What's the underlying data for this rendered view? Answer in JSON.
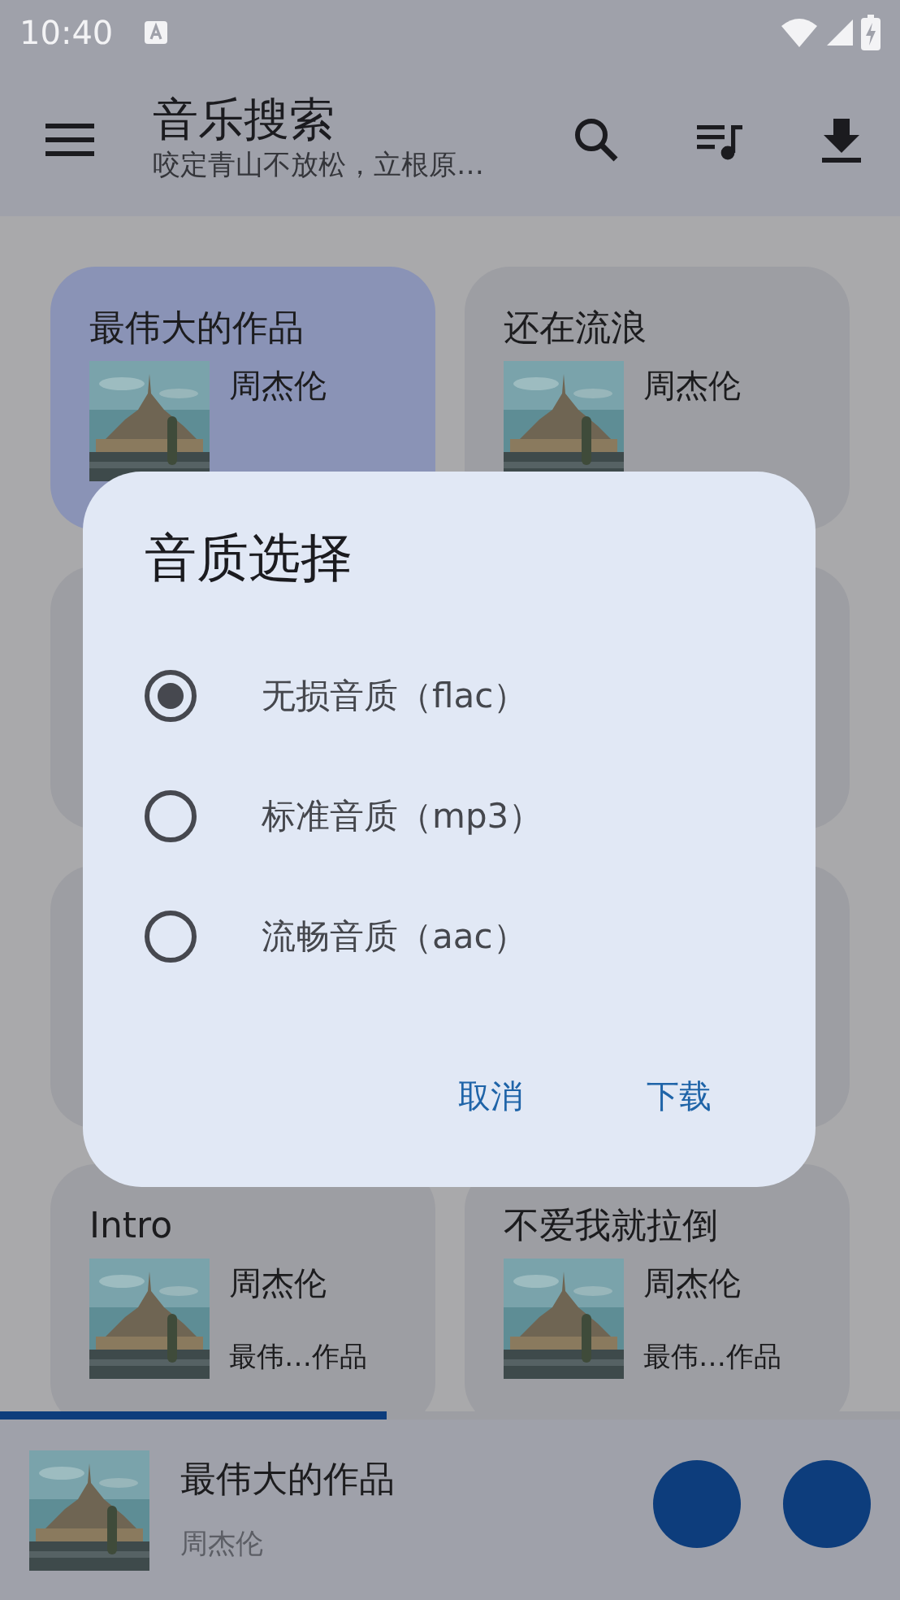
{
  "status_bar": {
    "time": "10:40"
  },
  "app_bar": {
    "title": "音乐搜索",
    "subtitle": "咬定青山不放松，立根原…"
  },
  "cards": [
    {
      "kind": "song",
      "title": "最伟大的作品",
      "artist": "周杰伦",
      "selected": true
    },
    {
      "kind": "song",
      "title": "还在流浪",
      "artist": "周杰伦",
      "selected": false
    },
    {
      "kind": "covered",
      "selected": false
    },
    {
      "kind": "covered",
      "selected": false
    },
    {
      "kind": "covered",
      "selected": false
    },
    {
      "kind": "covered",
      "selected": false
    },
    {
      "kind": "song",
      "title": "Intro",
      "artist": "周杰伦",
      "album": "最伟…作品",
      "selected": false
    },
    {
      "kind": "song",
      "title": "不爱我就拉倒",
      "artist": "周杰伦",
      "album": "最伟…作品",
      "selected": false
    }
  ],
  "player": {
    "title": "最伟大的作品",
    "artist": "周杰伦",
    "progress": {
      "level": 0.43
    }
  },
  "dialog": {
    "title": "音质选择",
    "options": [
      {
        "label": "无损音质（flac）",
        "selected": true
      },
      {
        "label": "标准音质（mp3）",
        "selected": false
      },
      {
        "label": "流畅音质（aac）",
        "selected": false
      }
    ],
    "buttons": [
      "取消",
      "下载"
    ]
  }
}
